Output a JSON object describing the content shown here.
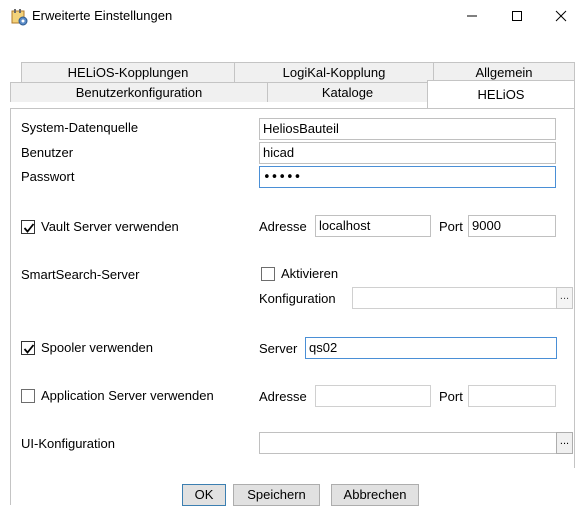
{
  "window": {
    "title": "Erweiterte Einstellungen",
    "icon": "settings-app-icon",
    "controls": {
      "minimize": "—",
      "maximize": "☐",
      "close": "✕"
    }
  },
  "tabs": {
    "row1": [
      "HELiOS-Kopplungen",
      "LogiKal-Kopplung",
      "Allgemein"
    ],
    "row2": [
      "Benutzerkonfiguration",
      "Kataloge",
      "HELiOS"
    ],
    "active": "HELiOS"
  },
  "helios": {
    "datasource_label": "System-Datenquelle",
    "datasource_value": "HeliosBauteil",
    "user_label": "Benutzer",
    "user_value": "hicad",
    "password_label": "Passwort",
    "password_value": "•••••",
    "vault": {
      "checkbox_label": "Vault Server verwenden",
      "checked": true,
      "address_label": "Adresse",
      "address_value": "localhost",
      "port_label": "Port",
      "port_value": "9000"
    },
    "smartsearch": {
      "label": "SmartSearch-Server",
      "activate_label": "Aktivieren",
      "activate_checked": false,
      "config_label": "Konfiguration",
      "config_value": "",
      "browse_label": "..."
    },
    "spooler": {
      "checkbox_label": "Spooler verwenden",
      "checked": true,
      "server_label": "Server",
      "server_value": "qs02"
    },
    "appserver": {
      "checkbox_label": "Application Server verwenden",
      "checked": false,
      "address_label": "Adresse",
      "address_value": "",
      "port_label": "Port",
      "port_value": ""
    },
    "ui_config": {
      "label": "UI-Konfiguration",
      "value": "",
      "browse_label": "..."
    }
  },
  "buttons": {
    "ok": "OK",
    "save": "Speichern",
    "cancel": "Abbrechen"
  },
  "colors": {
    "focus_border": "#4a8fd6",
    "button_bg": "#e1e1e1",
    "tab_bg": "#f0f0f0"
  }
}
